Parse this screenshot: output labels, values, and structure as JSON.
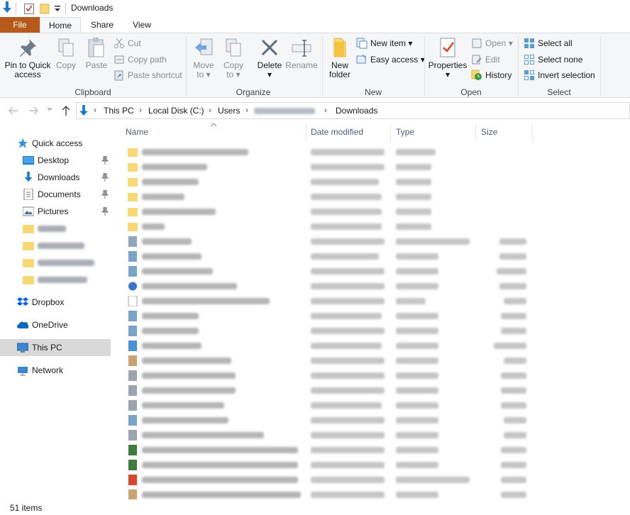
{
  "window": {
    "title": "Downloads"
  },
  "tabs": [
    {
      "label": "File"
    },
    {
      "label": "Home"
    },
    {
      "label": "Share"
    },
    {
      "label": "View"
    }
  ],
  "ribbon": {
    "clipboard": {
      "group_label": "Clipboard",
      "pin_label_1": "Pin to Quick",
      "pin_label_2": "access",
      "copy_label": "Copy",
      "paste_label": "Paste",
      "cut_label": "Cut",
      "copy_path_label": "Copy path",
      "paste_shortcut_label": "Paste shortcut"
    },
    "organize": {
      "group_label": "Organize",
      "move_label_1": "Move",
      "move_label_2": "to",
      "copyto_label_1": "Copy",
      "copyto_label_2": "to",
      "delete_label": "Delete",
      "rename_label": "Rename"
    },
    "new": {
      "group_label": "New",
      "new_folder_1": "New",
      "new_folder_2": "folder",
      "new_item_label": "New item",
      "easy_access_label": "Easy access"
    },
    "open": {
      "group_label": "Open",
      "properties_label": "Properties",
      "open_label": "Open",
      "edit_label": "Edit",
      "history_label": "History"
    },
    "select": {
      "group_label": "Select",
      "select_all_label": "Select all",
      "select_none_label": "Select none",
      "invert_label": "Invert selection"
    }
  },
  "address": {
    "crumbs": [
      "This PC",
      "Local Disk (C:)",
      "Users",
      "Downloads"
    ]
  },
  "nav": {
    "quick_access": "Quick access",
    "desktop": "Desktop",
    "downloads": "Downloads",
    "documents": "Documents",
    "pictures": "Pictures",
    "dropbox": "Dropbox",
    "onedrive": "OneDrive",
    "this_pc": "This PC",
    "network": "Network"
  },
  "columns": {
    "name": "Name",
    "date": "Date modified",
    "type": "Type",
    "size": "Size"
  },
  "status": {
    "item_count": "51 items"
  },
  "colors": {
    "file_tab": "#b55a1a",
    "folder": "#f8d775",
    "accent_blue": "#1979ca",
    "header_text": "#4c607a"
  }
}
